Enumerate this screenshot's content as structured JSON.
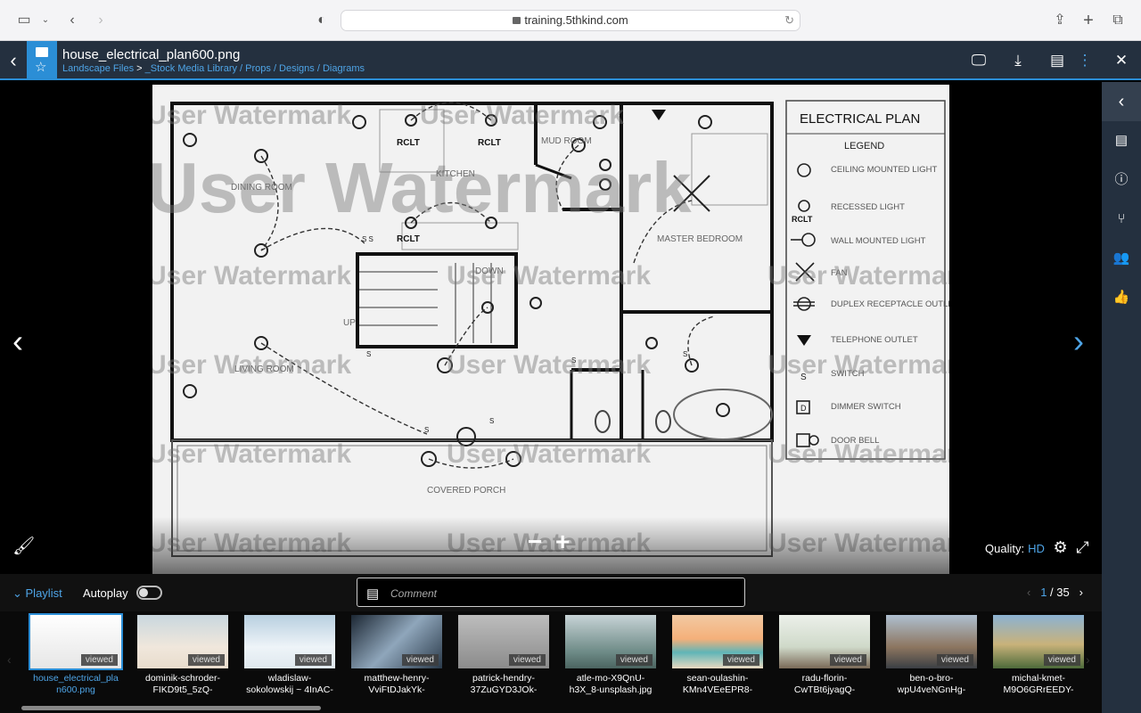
{
  "browser": {
    "url": "training.5thkind.com"
  },
  "header": {
    "file_name": "house_electrical_plan600.png",
    "breadcrumb_root": "Landscape Files",
    "breadcrumb_sep": " > ",
    "breadcrumb_path": "_Stock Media Library / Props / Designs / Diagrams"
  },
  "viewer": {
    "watermark": "User Watermark",
    "plan_title": "ELECTRICAL PLAN",
    "legend_title": "LEGEND",
    "legend": [
      "CEILING MOUNTED LIGHT",
      "RECESSED LIGHT",
      "WALL MOUNTED LIGHT",
      "FAN",
      "DUPLEX RECEPTACLE OUTLET",
      "TELEPHONE OUTLET",
      "SWITCH",
      "DIMMER SWITCH",
      "DOOR BELL"
    ],
    "rooms": [
      "DINING ROOM",
      "KITCHEN",
      "MUD ROOM",
      "MASTER BEDROOM",
      "LIVING ROOM",
      "COVERED PORCH",
      "DOWN",
      "UP"
    ],
    "rclt": "RCLT",
    "quality_label": "Quality:",
    "quality_value": "HD"
  },
  "controls": {
    "playlist": "Playlist",
    "autoplay": "Autoplay",
    "comment_placeholder": "Comment",
    "page_current": "1",
    "page_total": "/ 35"
  },
  "thumbnails": [
    {
      "label": "house_electrical_pla\nn600.png",
      "badge": "viewed",
      "active": true
    },
    {
      "label": "dominik-schroder-\nFIKD9t5_5zQ-",
      "badge": "viewed"
    },
    {
      "label": "wladislaw-\nsokolowskij ~ 4InAC-",
      "badge": "viewed"
    },
    {
      "label": "matthew-henry-\nVviFtDJakYk-",
      "badge": "viewed"
    },
    {
      "label": "patrick-hendry-\n37ZuGYD3JOk-",
      "badge": "viewed"
    },
    {
      "label": "atle-mo-X9QnU-\nh3X_8-unsplash.jpg",
      "badge": "viewed"
    },
    {
      "label": "sean-oulashin-\nKMn4VEeEPR8-",
      "badge": "viewed"
    },
    {
      "label": "radu-florin-\nCwTBt6jyagQ-",
      "badge": "viewed"
    },
    {
      "label": "ben-o-bro-\nwpU4veNGnHg-",
      "badge": "viewed"
    },
    {
      "label": "michal-kmet-\nM9O6GRrEEDY-",
      "badge": "viewed"
    }
  ]
}
